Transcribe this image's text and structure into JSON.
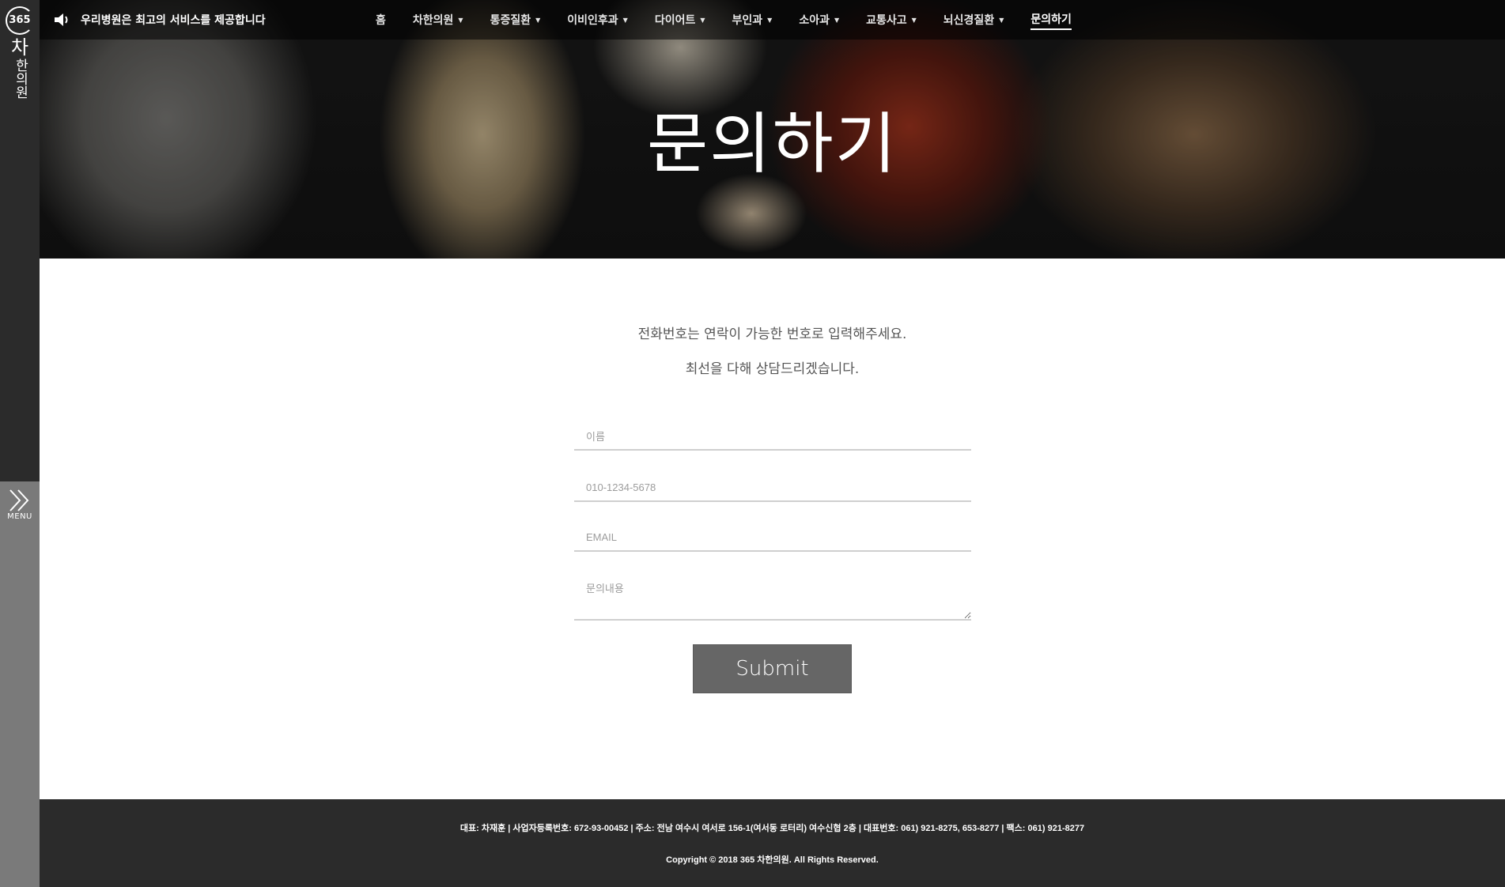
{
  "brand": {
    "logo_number": "365",
    "name_main": "차",
    "name_sub": "한의원"
  },
  "notice": {
    "icon": "speaker-icon",
    "text": "우리병원은 최고의 서비스를 제공합니다"
  },
  "nav": {
    "items": [
      {
        "label": "홈"
      },
      {
        "label": "차한의원"
      },
      {
        "label": "통증질환"
      },
      {
        "label": "이비인후과"
      },
      {
        "label": "다이어트"
      },
      {
        "label": "부인과"
      },
      {
        "label": "소아과"
      },
      {
        "label": "교통사고"
      },
      {
        "label": "뇌신경질환"
      },
      {
        "label": "문의하기"
      }
    ]
  },
  "hero": {
    "title": "문의하기"
  },
  "side_menu": {
    "label": "MENU",
    "icon": "double-chevron-right-icon"
  },
  "intro": {
    "line1": "전화번호는 연락이 가능한 번호로 입력해주세요.",
    "line2": "최선을 다해 상담드리겠습니다."
  },
  "form": {
    "name_placeholder": "이름",
    "phone_placeholder": "010-1234-5678",
    "email_placeholder": "EMAIL",
    "message_placeholder": "문의내용",
    "submit_label": "Submit"
  },
  "footer": {
    "info": "대표: 차재훈  |  사업자등록번호: 672-93-00452  |  주소: 전남 여수시 여서로 156-1(여서동 로터리) 여수신협 2층  |  대표번호: 061) 921-8275, 653-8277  |  팩스: 061) 921-8277",
    "copyright": "Copyright © 2018 365 차한의원. All Rights Reserved."
  },
  "colors": {
    "rail": "#2b2b2b",
    "rail_bottom": "#7a7a7a",
    "submit_bg": "#666666",
    "footer_bg": "#2b2b2b"
  }
}
